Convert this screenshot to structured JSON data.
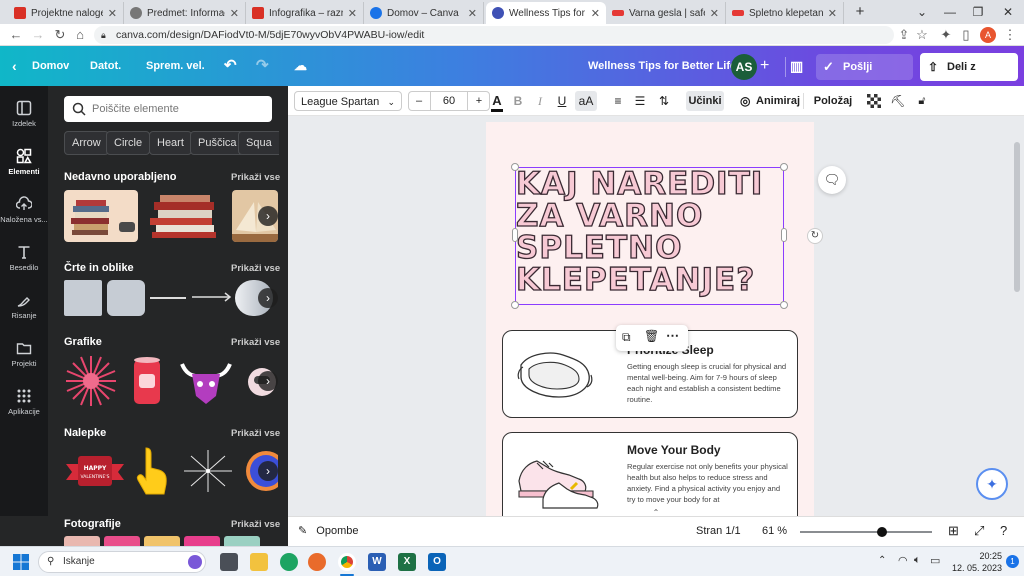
{
  "browser": {
    "tabs": [
      {
        "title": "Projektne naloge – ra",
        "color": "#d93025"
      },
      {
        "title": "Predmet: Informacijsk",
        "color": "#777777"
      },
      {
        "title": "Infografika – razredni",
        "color": "#d93025"
      },
      {
        "title": "Domov – Canva",
        "color": "#1a73e8"
      },
      {
        "title": "Wellness Tips for Bett",
        "color": "#3f51b5"
      },
      {
        "title": "Varna gesla | safe.si",
        "color": "#e53935"
      },
      {
        "title": "Spletno klepetanje | s",
        "color": "#e53935"
      }
    ],
    "new_tab": "+",
    "url": "canva.com/design/DAFiodVt0-M/5djE70wyvObV4PWABU-iow/edit"
  },
  "canva": {
    "home": "Domov",
    "file": "Datot.",
    "resize": "Sprem. vel.",
    "doc_title": "Wellness Tips for Better Life",
    "avatar": "AS",
    "send": "Pošlji učitelju",
    "share": "Deli z drugimi"
  },
  "rail": [
    {
      "label": "Izdelek",
      "icon": "layout-icon"
    },
    {
      "label": "Elementi",
      "icon": "elements-icon"
    },
    {
      "label": "Naložena vs...",
      "icon": "upload-icon"
    },
    {
      "label": "Besedilo",
      "icon": "text-icon"
    },
    {
      "label": "Risanje",
      "icon": "draw-icon"
    },
    {
      "label": "Projekti",
      "icon": "folder-icon"
    },
    {
      "label": "Aplikacije",
      "icon": "apps-icon"
    }
  ],
  "panel": {
    "search_placeholder": "Poiščite elemente",
    "chips": [
      "Arrow",
      "Circle",
      "Heart",
      "Puščica",
      "Squa"
    ],
    "see_all": "Prikaži vse",
    "sections": [
      "Nedavno uporabljeno",
      "Črte in oblike",
      "Grafike",
      "Nalepke",
      "Fotografije"
    ]
  },
  "toolbar": {
    "font": "League Spartan",
    "size": "60",
    "minus": "–",
    "plus": "+",
    "case": "aA",
    "effects": "Učinki",
    "animate": "Animiraj",
    "position": "Položaj"
  },
  "design": {
    "title": "KAJ NAREDITI ZA VARNO SPLETNO KLEPETANJE?",
    "card1_title": "Prioritize Sleep",
    "card1_body": "Getting enough sleep is crucial for physical and mental well-being. Aim for 7-9 hours of sleep each night and establish a consistent bedtime routine.",
    "card2_title": "Move Your Body",
    "card2_body": "Regular exercise not only benefits your physical health but also helps to reduce stress and anxiety. Find a physical activity you enjoy and try to move your body for at"
  },
  "bottom": {
    "notes": "Opombe",
    "page": "Stran 1/1",
    "zoom": "61 %",
    "zoom_level": 0.62
  },
  "taskbar": {
    "search": "Iskanje",
    "time": "20:25",
    "date": "12. 05. 2023"
  }
}
